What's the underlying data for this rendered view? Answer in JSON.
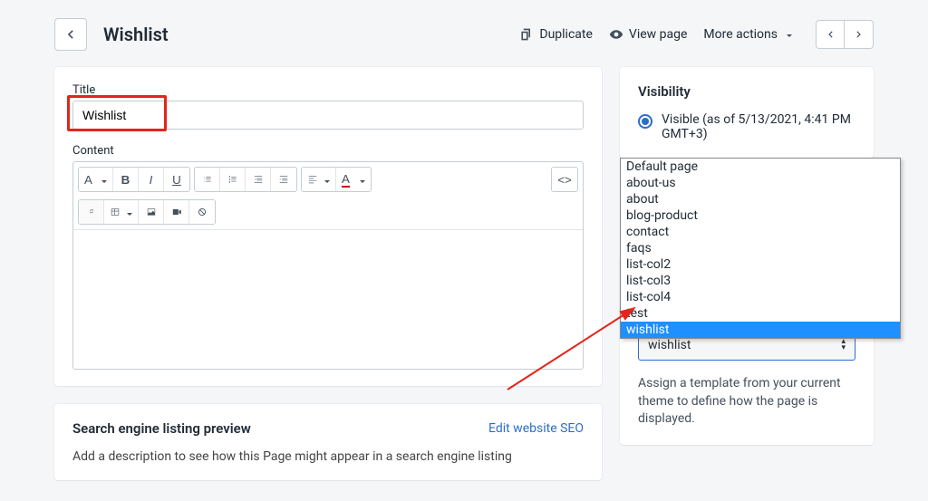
{
  "header": {
    "title": "Wishlist",
    "duplicate": "Duplicate",
    "viewPage": "View page",
    "moreActions": "More actions"
  },
  "main": {
    "titleLabel": "Title",
    "titleValue": "Wishlist",
    "contentLabel": "Content"
  },
  "toolbar": {
    "font": "A",
    "bold": "B",
    "italic": "I",
    "underline": "U",
    "color": "A",
    "code": "<>"
  },
  "seo": {
    "heading": "Search engine listing preview",
    "editLink": "Edit website SEO",
    "description": "Add a description to see how this Page might appear in a search engine listing"
  },
  "visibility": {
    "heading": "Visibility",
    "visibleLabel": "Visible (as of 5/13/2021, 4:41 PM GMT+3)"
  },
  "template": {
    "selected": "wishlist",
    "help": "Assign a template from your current theme to define how the page is displayed.",
    "options": [
      "Default page",
      "about-us",
      "about",
      "blog-product",
      "contact",
      "faqs",
      "list-col2",
      "list-col3",
      "list-col4",
      "test",
      "wishlist"
    ]
  }
}
